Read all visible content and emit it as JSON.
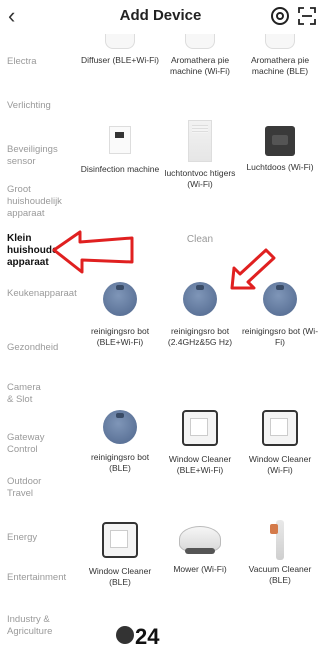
{
  "header": {
    "title": "Add Device",
    "back_icon": "chevron-left-icon"
  },
  "sidebar": {
    "items": [
      {
        "label": "Electra",
        "active": false
      },
      {
        "label": "Verlichting",
        "active": false
      },
      {
        "label": "Beveiligings sensor",
        "active": false
      },
      {
        "label": "Groot huishoudelijk apparaat",
        "active": false
      },
      {
        "label": "Klein huishoudelijk apparaat",
        "active": true
      },
      {
        "label": "Keukenapparaat",
        "active": false
      },
      {
        "label": "Gezondheid",
        "active": false
      },
      {
        "label": "Camera & Slot",
        "active": false
      },
      {
        "label": "Gateway Control",
        "active": false
      },
      {
        "label": "Outdoor Travel",
        "active": false
      },
      {
        "label": "Energy",
        "active": false
      },
      {
        "label": "Entertainment",
        "active": false
      },
      {
        "label": "Industry & Agriculture",
        "active": false
      }
    ]
  },
  "grid": {
    "row1": [
      {
        "label": "Diffuser (BLE+Wi-Fi)"
      },
      {
        "label": "Aromathera pie machine (Wi-Fi)"
      },
      {
        "label": "Aromathera pie machine (BLE)"
      }
    ],
    "row2": [
      {
        "label": "Disinfection machine"
      },
      {
        "label": "luchtontvoc htigers (Wi-Fi)"
      },
      {
        "label": "Luchtdoos (Wi-Fi)"
      }
    ],
    "section_clean": "Clean",
    "row3": [
      {
        "label": "reinigingsro bot (BLE+Wi-Fi)"
      },
      {
        "label": "reinigingsro bot (2.4GHz&5G Hz)"
      },
      {
        "label": "reinigingsro bot (Wi-Fi)"
      }
    ],
    "row4": [
      {
        "label": "reinigingsro bot (BLE)"
      },
      {
        "label": "Window Cleaner (BLE+Wi-Fi)"
      },
      {
        "label": "Window Cleaner (Wi-Fi)"
      }
    ],
    "row5": [
      {
        "label": "Window Cleaner (BLE)"
      },
      {
        "label": "Mower (Wi-Fi)"
      },
      {
        "label": "Vacuum Cleaner (BLE)"
      }
    ],
    "partial_bottom": "24"
  },
  "colors": {
    "annotation_red": "#e02020",
    "inactive_text": "#9a9a9a",
    "active_text": "#111111"
  }
}
